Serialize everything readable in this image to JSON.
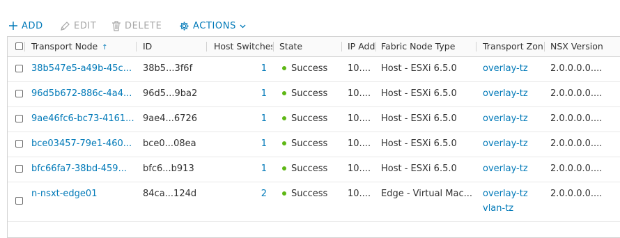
{
  "toolbar": {
    "add": "ADD",
    "edit": "EDIT",
    "delete": "DELETE",
    "actions": "ACTIONS"
  },
  "columns": {
    "transport_node": "Transport Node",
    "id": "ID",
    "host_switches": "Host Switches",
    "state": "State",
    "ip_addresses": "IP Add",
    "fabric_node_type": "Fabric Node Type",
    "transport_zones": "Transport Zon",
    "nsx_version": "NSX Version"
  },
  "rows": [
    {
      "name": "38b547e5-a49b-45c...",
      "id": "38b5...3f6f",
      "host_switches": "1",
      "state": "Success",
      "ip": "10....",
      "fabric_type": "Host - ESXi 6.5.0",
      "transport_zones": [
        "overlay-tz"
      ],
      "nsx_version": "2.0.0.0.0...."
    },
    {
      "name": "96d5b672-886c-4a4...",
      "id": "96d5...9ba2",
      "host_switches": "1",
      "state": "Success",
      "ip": "10....",
      "fabric_type": "Host - ESXi 6.5.0",
      "transport_zones": [
        "overlay-tz"
      ],
      "nsx_version": "2.0.0.0.0...."
    },
    {
      "name": "9ae46fc6-bc73-4161...",
      "id": "9ae4...6726",
      "host_switches": "1",
      "state": "Success",
      "ip": "10....",
      "fabric_type": "Host - ESXi 6.5.0",
      "transport_zones": [
        "overlay-tz"
      ],
      "nsx_version": "2.0.0.0.0...."
    },
    {
      "name": "bce03457-79e1-460...",
      "id": "bce0...08ea",
      "host_switches": "1",
      "state": "Success",
      "ip": "10....",
      "fabric_type": "Host - ESXi 6.5.0",
      "transport_zones": [
        "overlay-tz"
      ],
      "nsx_version": "2.0.0.0.0...."
    },
    {
      "name": "bfc66fa7-38bd-459...",
      "id": "bfc6...b913",
      "host_switches": "1",
      "state": "Success",
      "ip": "10....",
      "fabric_type": "Host - ESXi 6.5.0",
      "transport_zones": [
        "overlay-tz"
      ],
      "nsx_version": "2.0.0.0.0...."
    },
    {
      "name": "n-nsxt-edge01",
      "id": "84ca...124d",
      "host_switches": "2",
      "state": "Success",
      "ip": "10....",
      "fabric_type": "Edge - Virtual Mac...",
      "transport_zones": [
        "overlay-tz",
        "vlan-tz"
      ],
      "nsx_version": "2.0.0.0.0...."
    }
  ],
  "colors": {
    "accent": "#0079b8",
    "success": "#5eb715",
    "disabled": "#a6a6a6"
  }
}
